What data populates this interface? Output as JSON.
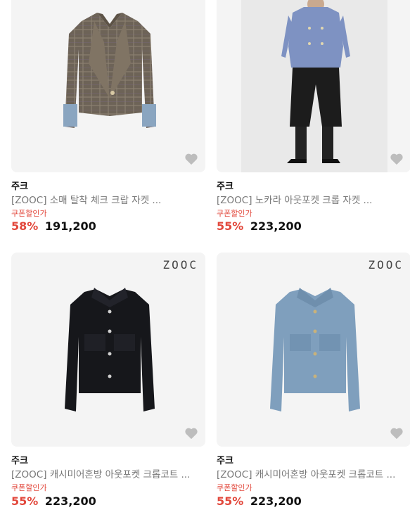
{
  "products": [
    {
      "brand": "주크",
      "title": "[ZOOC] 소매 탈착 체크 크랍 자켓 ...",
      "coupon": "쿠폰할인가",
      "discount": "58%",
      "price": "191,200",
      "logo": "",
      "image": "checked-crop-jacket-image",
      "colors": {
        "body": "#6d6357",
        "cuff": "#8aa5c0"
      }
    },
    {
      "brand": "주크",
      "title": "[ZOOC] 노카라 아웃포켓 크롭 자켓 ...",
      "coupon": "쿠폰할인가",
      "discount": "55%",
      "price": "223,200",
      "logo": "",
      "image": "model-blue-jacket-image",
      "colors": {
        "body": "#7e92c2",
        "pants": "#1c1c1c"
      }
    },
    {
      "brand": "주크",
      "title": "[ZOOC] 캐시미어혼방 아웃포켓 크롭코트 ...",
      "coupon": "쿠폰할인가",
      "discount": "55%",
      "price": "223,200",
      "logo": "ZOOC",
      "image": "black-crop-coat-image",
      "colors": {
        "body": "#16171b"
      }
    },
    {
      "brand": "주크",
      "title": "[ZOOC] 캐시미어혼방 아웃포켓 크롭코트 ...",
      "coupon": "쿠폰할인가",
      "discount": "55%",
      "price": "223,200",
      "logo": "ZOOC",
      "image": "blue-crop-coat-image",
      "colors": {
        "body": "#7f9fbd"
      }
    }
  ],
  "icons": {
    "wishlist": "heart-icon"
  },
  "theme": {
    "accent": "#e2473b",
    "heart": "#bdbdbd",
    "imageBg": "#f4f4f4"
  }
}
